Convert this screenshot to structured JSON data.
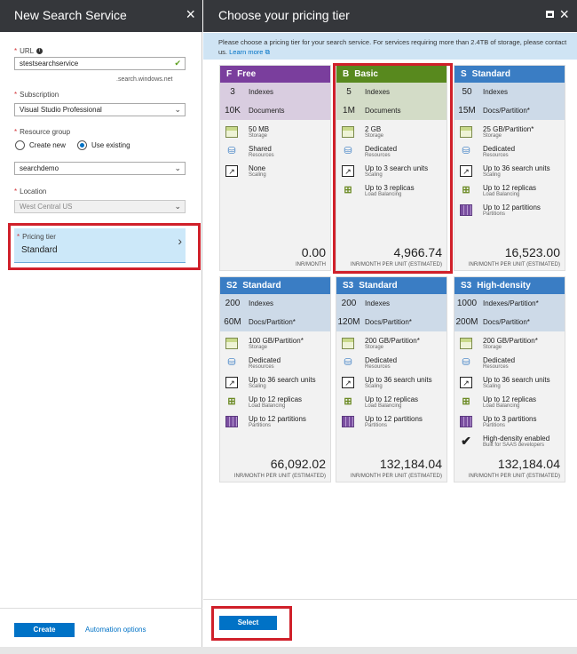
{
  "left_blade": {
    "title": "New Search Service",
    "close": "×",
    "url": {
      "label": "URL",
      "required": "*",
      "info": "i",
      "value": "stestsearchservice",
      "valid_mark": "✔",
      "suffix": ".search.windows.net"
    },
    "subscription": {
      "label": "Subscription",
      "required": "*",
      "value": "Visual Studio Professional"
    },
    "resource_group": {
      "label": "Resource group",
      "required": "*",
      "option_new": "Create new",
      "option_existing": "Use existing",
      "selected": "Use existing",
      "value": "searchdemo"
    },
    "location": {
      "label": "Location",
      "required": "*",
      "value": "West Central US"
    },
    "pricing_tier": {
      "label": "Pricing tier",
      "required": "*",
      "value": "Standard",
      "chevron": "›"
    },
    "create_label": "Create",
    "automation_label": "Automation options"
  },
  "right_blade": {
    "title": "Choose your pricing tier",
    "banner_text": "Please choose a pricing tier for your search service. For services requiring more than 2.4TB of storage, please contact us.",
    "learn_more": "Learn more",
    "select_label": "Select",
    "tiers": [
      {
        "code": "F",
        "name": "Free",
        "color": "#7a3e9d",
        "indexes": "3",
        "indexes_label": "Indexes",
        "docs": "10K",
        "docs_label": "Documents",
        "features": [
          {
            "icon": "storage-icon",
            "main": "50 MB",
            "sub": "Storage"
          },
          {
            "icon": "resources-icon",
            "main": "Shared",
            "sub": "Resources"
          },
          {
            "icon": "scaling-icon",
            "main": "None",
            "sub": "Scaling"
          }
        ],
        "price": "0.00",
        "unit": "INR/MONTH"
      },
      {
        "code": "B",
        "name": "Basic",
        "color": "#58891e",
        "indexes": "5",
        "indexes_label": "Indexes",
        "docs": "1M",
        "docs_label": "Documents",
        "features": [
          {
            "icon": "storage-icon",
            "main": "2 GB",
            "sub": "Storage"
          },
          {
            "icon": "resources-icon",
            "main": "Dedicated",
            "sub": "Resources"
          },
          {
            "icon": "scaling-icon",
            "main": "Up to 3 search units",
            "sub": "Scaling"
          },
          {
            "icon": "load-balancing-icon",
            "main": "Up to 3 replicas",
            "sub": "Load Balancing"
          }
        ],
        "price": "4,966.74",
        "unit": "INR/MONTH PER UNIT (ESTIMATED)"
      },
      {
        "code": "S",
        "name": "Standard",
        "color": "#3a7dc4",
        "indexes": "50",
        "indexes_label": "Indexes",
        "docs": "15M",
        "docs_label": "Docs/Partition*",
        "features": [
          {
            "icon": "storage-icon",
            "main": "25 GB/Partition*",
            "sub": "Storage"
          },
          {
            "icon": "resources-icon",
            "main": "Dedicated",
            "sub": "Resources"
          },
          {
            "icon": "scaling-icon",
            "main": "Up to 36 search units",
            "sub": "Scaling"
          },
          {
            "icon": "load-balancing-icon",
            "main": "Up to 12 replicas",
            "sub": "Load Balancing"
          },
          {
            "icon": "partitions-icon",
            "main": "Up to 12 partitions",
            "sub": "Partitions"
          }
        ],
        "price": "16,523.00",
        "unit": "INR/MONTH PER UNIT (ESTIMATED)"
      },
      {
        "code": "S2",
        "name": "Standard",
        "color": "#3a7dc4",
        "indexes": "200",
        "indexes_label": "Indexes",
        "docs": "60M",
        "docs_label": "Docs/Partition*",
        "features": [
          {
            "icon": "storage-icon",
            "main": "100 GB/Partition*",
            "sub": "Storage"
          },
          {
            "icon": "resources-icon",
            "main": "Dedicated",
            "sub": "Resources"
          },
          {
            "icon": "scaling-icon",
            "main": "Up to 36 search units",
            "sub": "Scaling"
          },
          {
            "icon": "load-balancing-icon",
            "main": "Up to 12 replicas",
            "sub": "Load Balancing"
          },
          {
            "icon": "partitions-icon",
            "main": "Up to 12 partitions",
            "sub": "Partitions"
          }
        ],
        "price": "66,092.02",
        "unit": "INR/MONTH PER UNIT (ESTIMATED)"
      },
      {
        "code": "S3",
        "name": "Standard",
        "color": "#3a7dc4",
        "indexes": "200",
        "indexes_label": "Indexes",
        "docs": "120M",
        "docs_label": "Docs/Partition*",
        "features": [
          {
            "icon": "storage-icon",
            "main": "200 GB/Partition*",
            "sub": "Storage"
          },
          {
            "icon": "resources-icon",
            "main": "Dedicated",
            "sub": "Resources"
          },
          {
            "icon": "scaling-icon",
            "main": "Up to 36 search units",
            "sub": "Scaling"
          },
          {
            "icon": "load-balancing-icon",
            "main": "Up to 12 replicas",
            "sub": "Load Balancing"
          },
          {
            "icon": "partitions-icon",
            "main": "Up to 12 partitions",
            "sub": "Partitions"
          }
        ],
        "price": "132,184.04",
        "unit": "INR/MONTH PER UNIT (ESTIMATED)"
      },
      {
        "code": "S3",
        "name": "High-density",
        "color": "#3a7dc4",
        "indexes": "1000",
        "indexes_label": "Indexes/Partition*",
        "docs": "200M",
        "docs_label": "Docs/Partition*",
        "features": [
          {
            "icon": "storage-icon",
            "main": "200 GB/Partition*",
            "sub": "Storage"
          },
          {
            "icon": "resources-icon",
            "main": "Dedicated",
            "sub": "Resources"
          },
          {
            "icon": "scaling-icon",
            "main": "Up to 36 search units",
            "sub": "Scaling"
          },
          {
            "icon": "load-balancing-icon",
            "main": "Up to 12 replicas",
            "sub": "Load Balancing"
          },
          {
            "icon": "partitions-icon",
            "main": "Up to 3 partitions",
            "sub": "Partitions"
          },
          {
            "icon": "check-icon",
            "main": "High-density enabled",
            "sub": "Built for SAAS developers"
          }
        ],
        "price": "132,184.04",
        "unit": "INR/MONTH PER UNIT (ESTIMATED)"
      }
    ]
  }
}
